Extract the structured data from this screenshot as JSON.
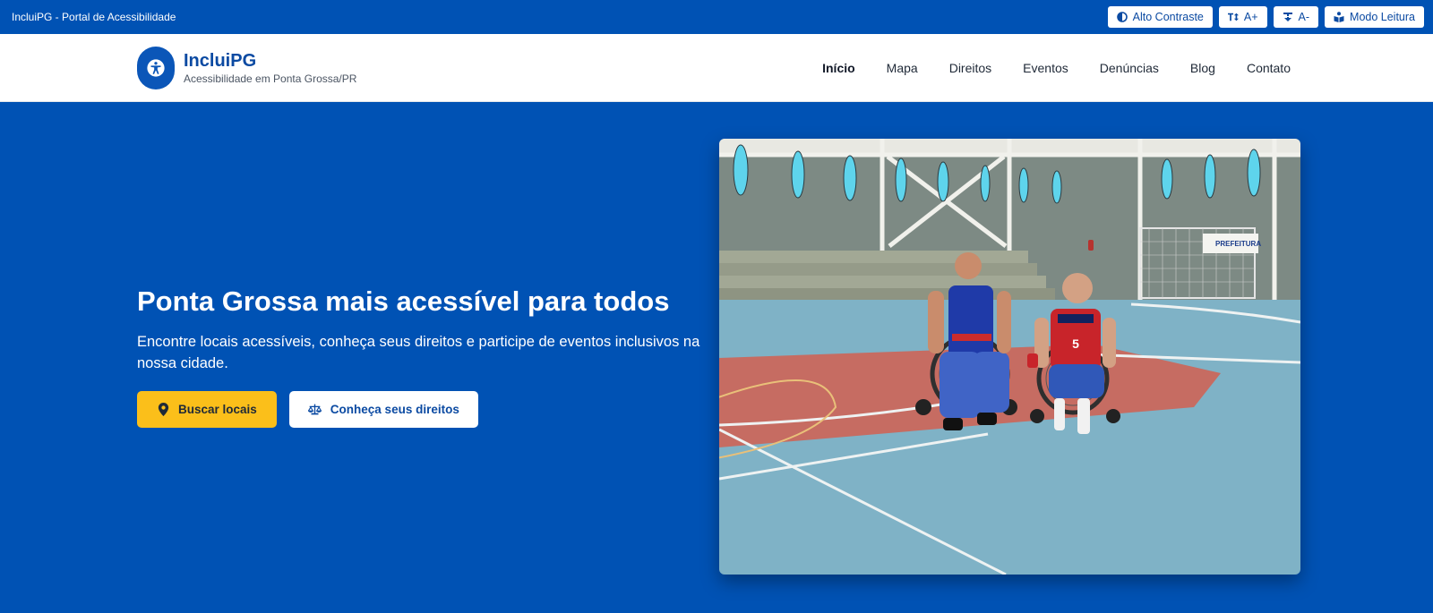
{
  "topbar": {
    "title": "IncluiPG - Portal de Acessibilidade",
    "tools": [
      {
        "label": "Alto Contraste",
        "icon": "contrast-icon"
      },
      {
        "label": "A+",
        "icon": "text-increase-icon"
      },
      {
        "label": "A-",
        "icon": "text-decrease-icon"
      },
      {
        "label": "Modo Leitura",
        "icon": "book-reader-icon"
      }
    ]
  },
  "header": {
    "logo_title": "IncluiPG",
    "logo_subtitle": "Acessibilidade em Ponta Grossa/PR",
    "logo_icon": "universal-access-icon",
    "nav": [
      {
        "label": "Início",
        "active": true
      },
      {
        "label": "Mapa"
      },
      {
        "label": "Direitos"
      },
      {
        "label": "Eventos"
      },
      {
        "label": "Denúncias"
      },
      {
        "label": "Blog"
      },
      {
        "label": "Contato"
      }
    ]
  },
  "hero": {
    "title": "Ponta Grossa mais acessível para todos",
    "subtitle": "Encontre locais acessíveis, conheça seus direitos e participe de eventos inclusivos na nossa cidade.",
    "primary_button": {
      "label": "Buscar locais",
      "icon": "map-marker-icon"
    },
    "secondary_button": {
      "label": "Conheça seus direitos",
      "icon": "balance-scale-icon"
    },
    "image": {
      "jersey_number": "5",
      "banner_text": "PREFEITURA"
    }
  },
  "colors": {
    "brand_blue": "#0052b4",
    "accent_yellow": "#fbbf1a",
    "white": "#ffffff"
  }
}
